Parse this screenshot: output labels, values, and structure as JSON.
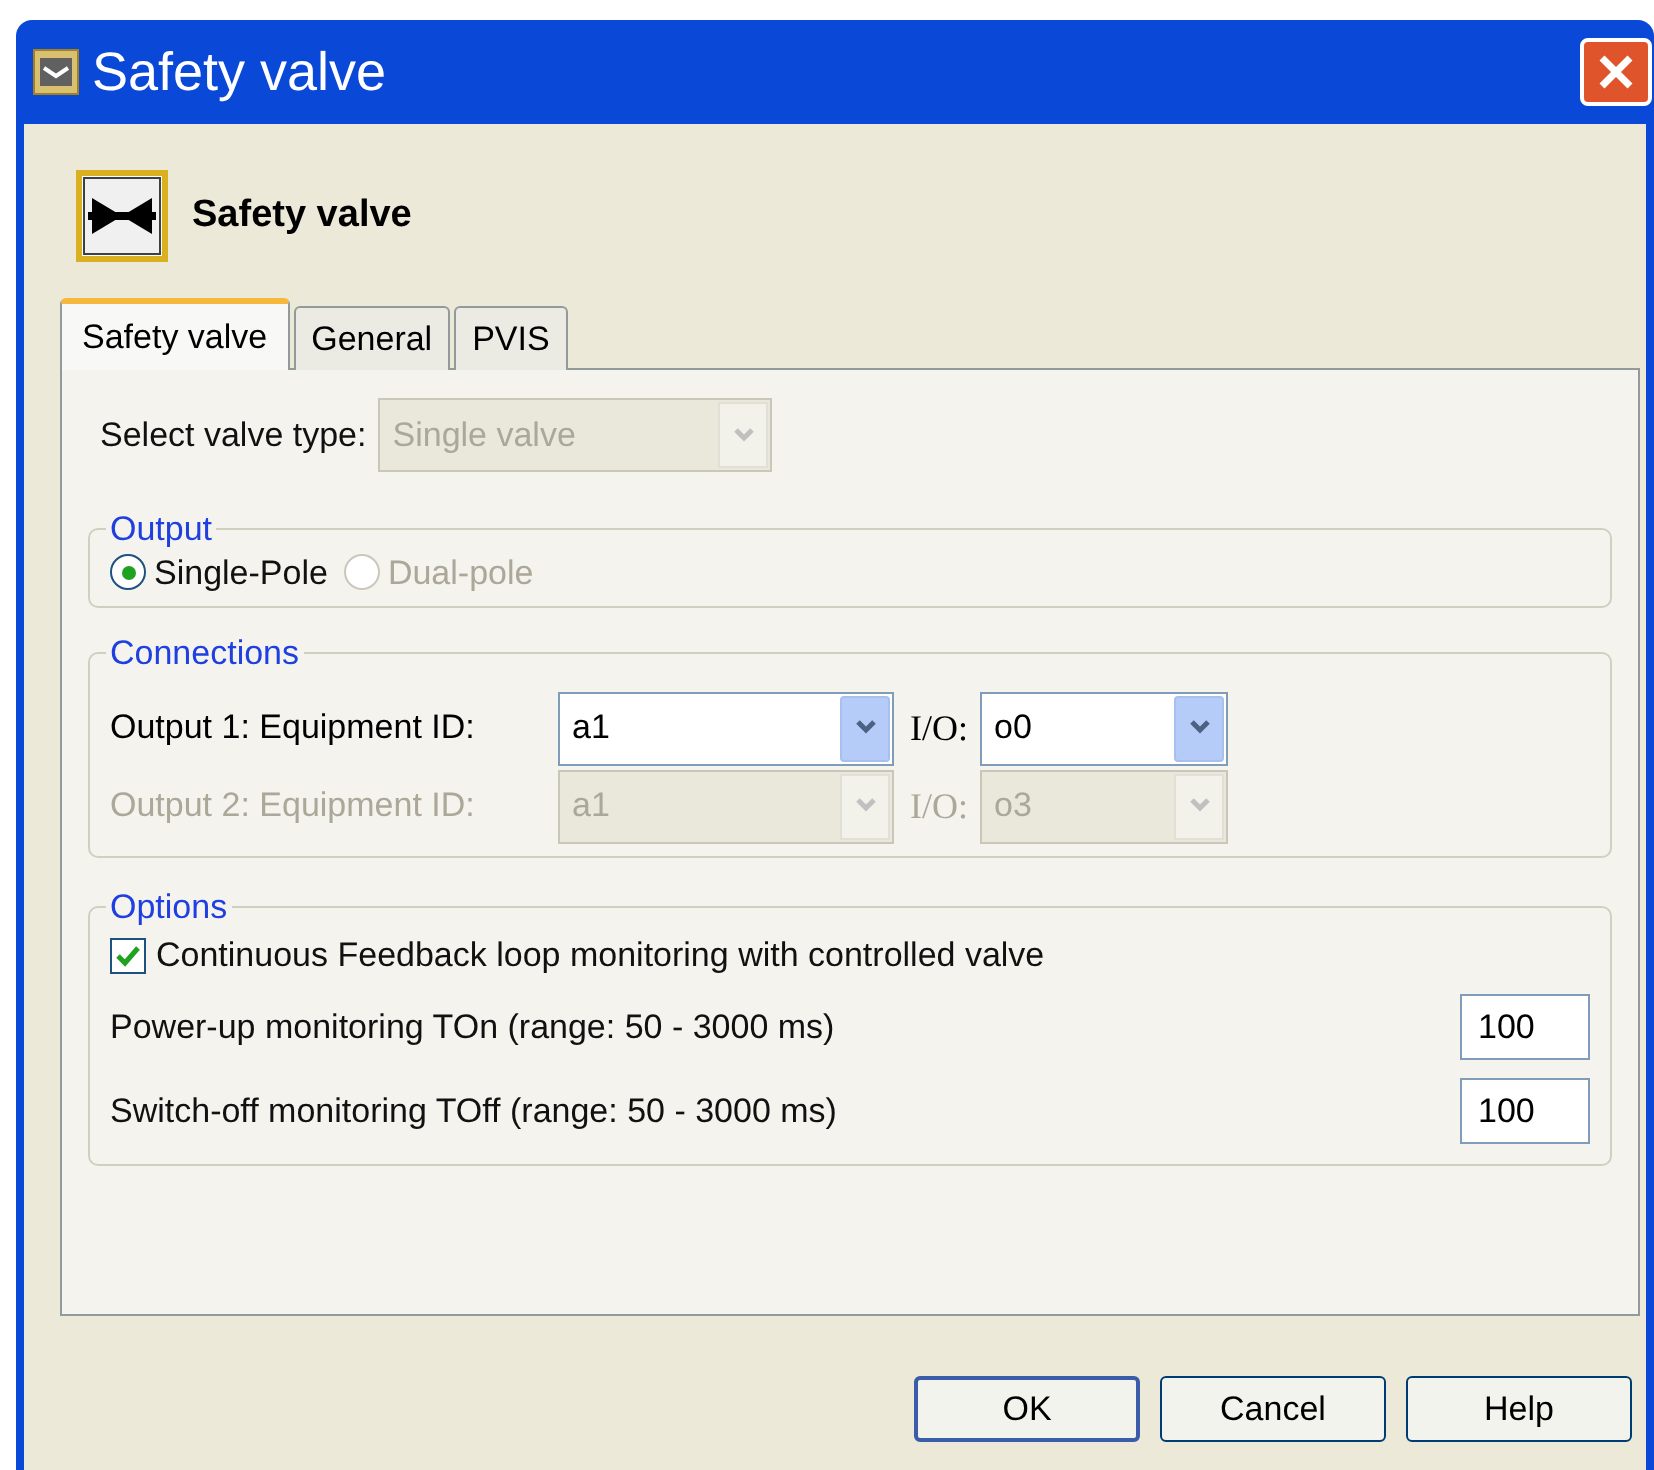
{
  "window": {
    "title": "Safety valve"
  },
  "header": {
    "title": "Safety valve"
  },
  "tabs": [
    {
      "label": "Safety valve",
      "selected": true
    },
    {
      "label": "General",
      "selected": false
    },
    {
      "label": "PVIS",
      "selected": false
    }
  ],
  "valve_type": {
    "label": "Select valve type:",
    "value": "Single valve",
    "disabled": true
  },
  "output": {
    "title": "Output",
    "options": [
      {
        "label": "Single-Pole",
        "selected": true,
        "disabled": false
      },
      {
        "label": "Dual-pole",
        "selected": false,
        "disabled": true
      }
    ]
  },
  "connections": {
    "title": "Connections",
    "rows": [
      {
        "label": "Output 1: Equipment ID:",
        "equipment_id": "a1",
        "io_label": "I/O:",
        "io": "o0",
        "disabled": false
      },
      {
        "label": "Output 2: Equipment ID:",
        "equipment_id": "a1",
        "io_label": "I/O:",
        "io": "o3",
        "disabled": true
      }
    ]
  },
  "options": {
    "title": "Options",
    "feedback": {
      "label": "Continuous Feedback loop monitoring with controlled valve",
      "checked": true
    },
    "fields": [
      {
        "label": "Power-up monitoring TOn (range: 50 - 3000 ms)",
        "value": "100"
      },
      {
        "label": "Switch-off monitoring TOff (range: 50 - 3000 ms)",
        "value": "100"
      }
    ]
  },
  "buttons": [
    {
      "label": "OK",
      "default": true
    },
    {
      "label": "Cancel",
      "default": false
    },
    {
      "label": "Help",
      "default": false
    }
  ]
}
